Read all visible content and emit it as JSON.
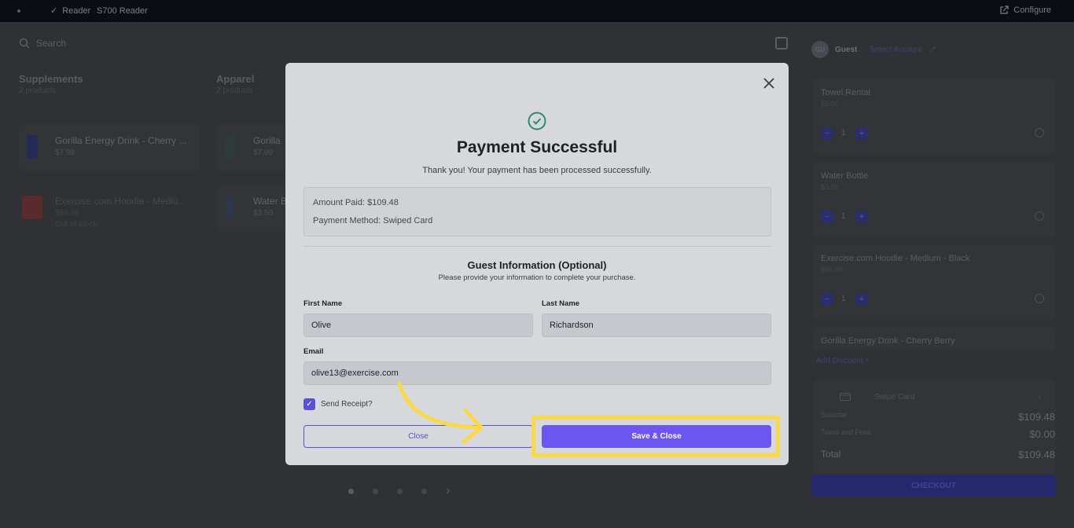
{
  "topbar": {
    "reader_label": "Reader",
    "reader_name": "S700 Reader",
    "configure_label": "Configure"
  },
  "background": {
    "search_placeholder": "Search",
    "categories": [
      {
        "name": "Supplements",
        "count": "2 products"
      },
      {
        "name": "Apparel",
        "count": "2 products"
      }
    ],
    "products": [
      {
        "name": "Gorilla Energy Drink - Cherry ...",
        "price": "$7.99",
        "stock": ""
      },
      {
        "name": "Gorilla",
        "price": "$7.99",
        "stock": ""
      },
      {
        "name": "Exercise.com Hoodie - Mediu...",
        "price": "$59.99",
        "stock": "Out of stock"
      },
      {
        "name": "Water B",
        "price": "$3.50",
        "stock": ""
      }
    ]
  },
  "cart": {
    "avatar_initials": "GU",
    "user_label": "Guest",
    "select_account": "Select Account",
    "items": [
      {
        "name": "Towel Rental",
        "price": "$5.00",
        "qty": "1"
      },
      {
        "name": "Water Bottle",
        "price": "$3.50",
        "qty": "1"
      },
      {
        "name": "Exercise.com Hoodie - Medium - Black",
        "price": "$59.99",
        "qty": "1"
      },
      {
        "name": "Gorilla Energy Drink - Cherry Berry",
        "price": "",
        "qty": ""
      }
    ],
    "add_discount": "Add Discount",
    "payment_method": "Swipe Card",
    "subtotal_label": "Subtotal",
    "subtotal_value": "$109.48",
    "taxes_label": "Taxes and Fees",
    "taxes_value": "$0.00",
    "total_label": "Total",
    "total_value": "$109.48",
    "checkout_label": "CHECKOUT"
  },
  "modal": {
    "title": "Payment Successful",
    "subtitle": "Thank you! Your payment has been processed successfully.",
    "amount_paid_label": "Amount Paid:",
    "amount_paid_value": "$109.48",
    "payment_method_label": "Payment Method:",
    "payment_method_value": "Swiped Card",
    "guest_title": "Guest Information (Optional)",
    "guest_subtitle": "Please provide your information to complete your purchase.",
    "first_name_label": "First Name",
    "first_name_value": "Olive",
    "last_name_label": "Last Name",
    "last_name_value": "Richardson",
    "email_label": "Email",
    "email_value": "olive13@exercise.com",
    "send_receipt_label": "Send Receipt?",
    "send_receipt_checked": true,
    "close_label": "Close",
    "save_label": "Save & Close"
  },
  "colors": {
    "accent": "#6d55f0",
    "highlight": "#f9d94a",
    "success": "#2f8a6d"
  }
}
